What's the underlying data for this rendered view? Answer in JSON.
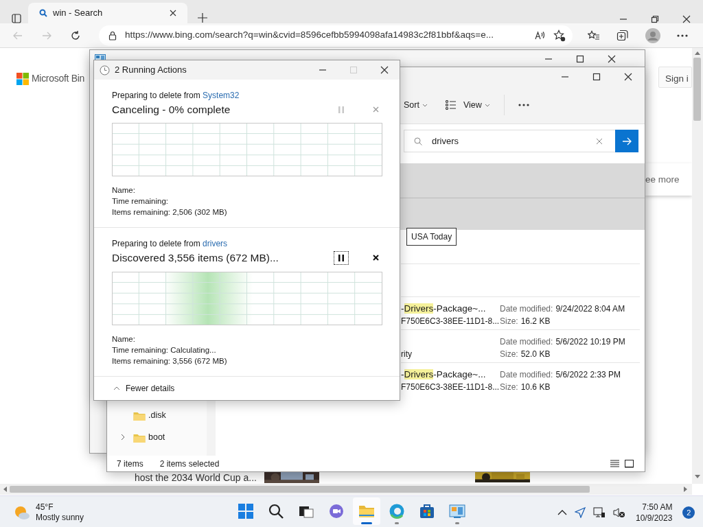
{
  "browser": {
    "tab": {
      "title": "win - Search",
      "selected": true
    },
    "nav_buttons": [
      {
        "kind": "back",
        "disabled": true
      },
      {
        "kind": "forward",
        "disabled": true
      },
      {
        "kind": "refresh",
        "disabled": false
      }
    ],
    "url": "https://www.bing.com/search?q=win&cvid=8596cefbb5994098afa14983c2f81bbf&aqs=e..."
  },
  "page": {
    "logo": "Microsoft Bin",
    "sign_in": "Sign i",
    "see_more": "ee more",
    "headline": "host the 2034 World Cup a...",
    "tooltip": "USA Today"
  },
  "control_panel": {
    "kind": "window"
  },
  "explorer": {
    "toolbar": [
      {
        "kind": "sort",
        "label": "Sort"
      },
      {
        "kind": "view",
        "label": "View"
      },
      {
        "kind": "more"
      }
    ],
    "search": {
      "value": "drivers"
    },
    "results": [
      {
        "title": {
          "before": "-",
          "match": "Drivers",
          "after": "-Package~..."
        },
        "subtitle": "F750E6C3-38EE-11D1-8...",
        "date_label": "Date modified:",
        "date": "9/24/2022 8:04 AM",
        "size_label": "Size:",
        "size": "16.2 KB"
      },
      {
        "subtitle": "rity",
        "date_label": "Date modified:",
        "date": "5/6/2022 10:19 PM",
        "size_label": "Size:",
        "size": "52.0 KB"
      },
      {
        "title": {
          "before": "-",
          "match": "Drivers",
          "after": "-Package~..."
        },
        "subtitle": "F750E6C3-38EE-11D1-8...",
        "date_label": "Date modified:",
        "date": "5/6/2022 2:33 PM",
        "size_label": "Size:",
        "size": "10.6 KB"
      }
    ],
    "nav": [
      {
        "label": ".disk"
      },
      {
        "label": "boot",
        "expanded": false
      }
    ],
    "status": [
      "7 items",
      "2 items selected"
    ]
  },
  "dialog": {
    "title": "2 Running Actions",
    "operations": [
      {
        "prefix": "Preparing to delete from",
        "source": "System32",
        "status": "Canceling - 0% complete",
        "pause_enabled": false,
        "focused": false,
        "activity": false,
        "details": [
          {
            "label": "Name:"
          },
          {
            "label": "Time remaining:"
          },
          {
            "label": "Items remaining:",
            "value": "2,506 (302 MB)"
          }
        ]
      },
      {
        "prefix": "Preparing to delete from",
        "source": "drivers",
        "status": "Discovered 3,556 items (672 MB)...",
        "pause_enabled": true,
        "focused": true,
        "activity": true,
        "details": [
          {
            "label": "Name:"
          },
          {
            "label": "Time remaining:",
            "value": "Calculating..."
          },
          {
            "label": "Items remaining:",
            "value": "3,556 (672 MB)"
          }
        ]
      }
    ],
    "footer": "Fewer details"
  },
  "taskbar": {
    "weather": {
      "temp": "45°F",
      "text": "Mostly sunny"
    },
    "apps": [
      {
        "kind": "start",
        "running": false,
        "active": false
      },
      {
        "kind": "search",
        "running": false,
        "active": false
      },
      {
        "kind": "taskview",
        "running": false,
        "active": false
      },
      {
        "kind": "chat",
        "running": false,
        "active": false
      },
      {
        "kind": "explorer",
        "running": true,
        "active": true
      },
      {
        "kind": "edge",
        "running": true,
        "active": false
      },
      {
        "kind": "store",
        "running": false,
        "active": false
      },
      {
        "kind": "control",
        "running": true,
        "active": false
      }
    ],
    "time": "7:50 AM",
    "date": "10/9/2023",
    "notifications": "2"
  }
}
